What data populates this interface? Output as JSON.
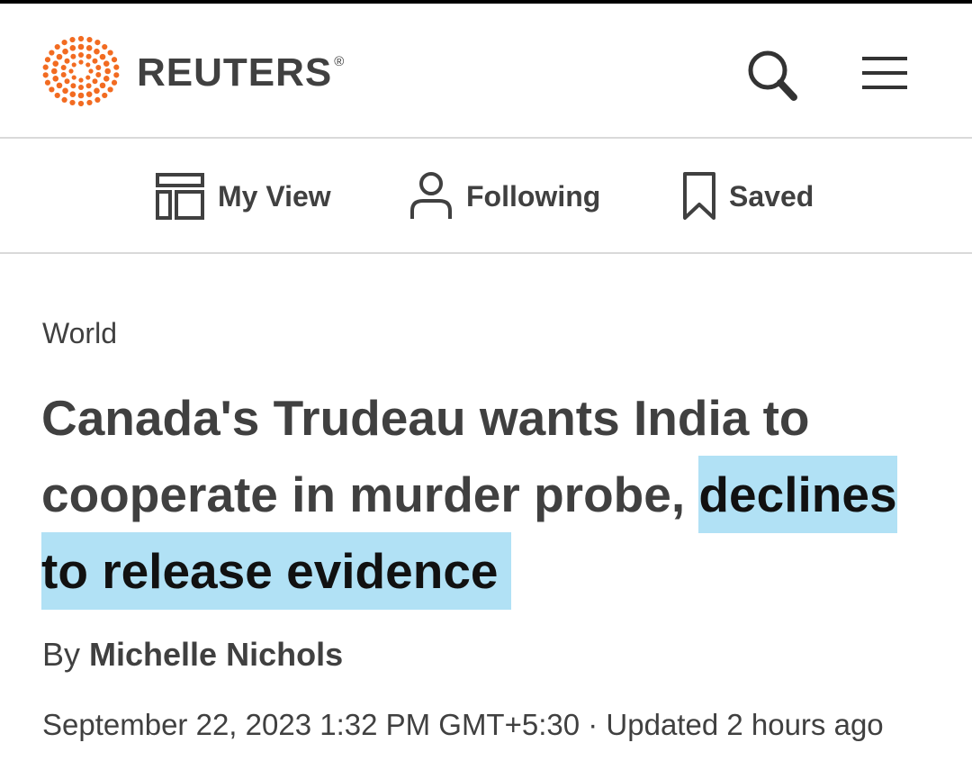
{
  "brand": {
    "name": "REUTERS",
    "registered_mark": "®",
    "accent_color": "#f26b21"
  },
  "header": {
    "search_icon": "search-icon",
    "menu_icon": "hamburger-menu-icon"
  },
  "nav": {
    "items": [
      {
        "label": "My View",
        "icon": "layout-grid-icon"
      },
      {
        "label": "Following",
        "icon": "person-icon"
      },
      {
        "label": "Saved",
        "icon": "bookmark-icon"
      }
    ]
  },
  "article": {
    "section": "World",
    "headline_plain": "Canada's Trudeau wants India to cooperate in murder probe,",
    "headline_highlighted": "declines to release evidence",
    "highlight_color": "#b1e1f5",
    "byline_prefix": "By",
    "author": "Michelle Nichols",
    "dateline": "September 22, 2023 1:32 PM GMT+5:30 · Updated 2 hours ago"
  }
}
